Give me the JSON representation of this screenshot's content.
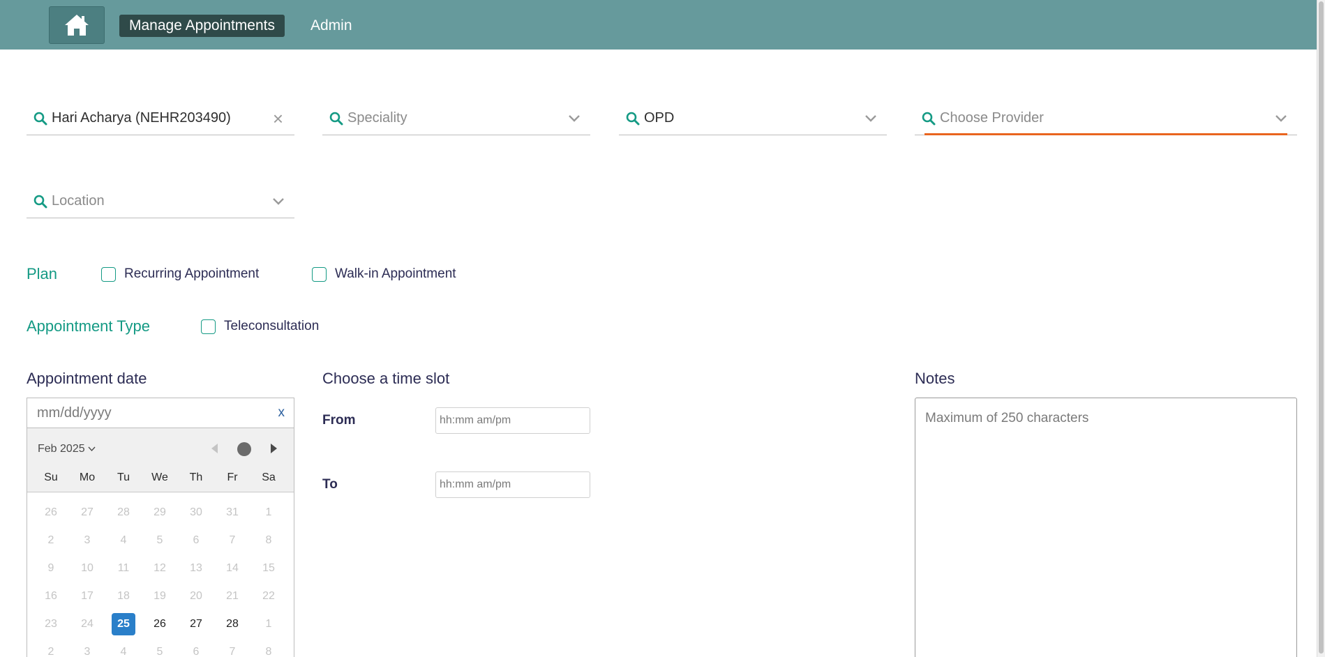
{
  "nav": {
    "home_icon": "home-icon",
    "items": [
      {
        "label": "Manage Appointments",
        "active": true
      },
      {
        "label": "Admin",
        "active": false
      }
    ],
    "bg_color": "#669a9c",
    "active_color": "#2f4a49"
  },
  "filters": {
    "patient": {
      "value": "Hari Acharya (NEHR203490)",
      "clear": "×"
    },
    "speciality": {
      "placeholder": "Speciality"
    },
    "service": {
      "value": "OPD"
    },
    "provider": {
      "placeholder": "Choose Provider"
    },
    "location": {
      "placeholder": "Location"
    }
  },
  "plan": {
    "label": "Plan",
    "options": [
      {
        "label": "Recurring Appointment",
        "checked": false
      },
      {
        "label": "Walk-in Appointment",
        "checked": false
      }
    ]
  },
  "appointment_type": {
    "label": "Appointment Type",
    "options": [
      {
        "label": "Teleconsultation",
        "checked": false
      }
    ]
  },
  "date": {
    "heading": "Appointment date",
    "placeholder": "mm/dd/yyyy",
    "clear": "x",
    "calendar": {
      "month_label": "Feb 2025",
      "weekdays": [
        "Su",
        "Mo",
        "Tu",
        "We",
        "Th",
        "Fr",
        "Sa"
      ],
      "weeks": [
        [
          "26",
          "27",
          "28",
          "29",
          "30",
          "31",
          "1"
        ],
        [
          "2",
          "3",
          "4",
          "5",
          "6",
          "7",
          "8"
        ],
        [
          "9",
          "10",
          "11",
          "12",
          "13",
          "14",
          "15"
        ],
        [
          "16",
          "17",
          "18",
          "19",
          "20",
          "21",
          "22"
        ],
        [
          "23",
          "24",
          "25",
          "26",
          "27",
          "28",
          "1"
        ],
        [
          "2",
          "3",
          "4",
          "5",
          "6",
          "7",
          "8"
        ]
      ],
      "selected_day": "25",
      "selectable_days": [
        "25",
        "26",
        "27",
        "28"
      ],
      "selected_color": "#2a7fc9"
    }
  },
  "time": {
    "heading": "Choose a time slot",
    "from_label": "From",
    "to_label": "To",
    "from_placeholder": "hh:mm am/pm",
    "to_placeholder": "hh:mm am/pm"
  },
  "notes": {
    "heading": "Notes",
    "placeholder": "Maximum of 250 characters"
  },
  "colors": {
    "accent_teal": "#149a84",
    "focus_orange": "#e9651f",
    "text_navy": "#2c2c54"
  }
}
